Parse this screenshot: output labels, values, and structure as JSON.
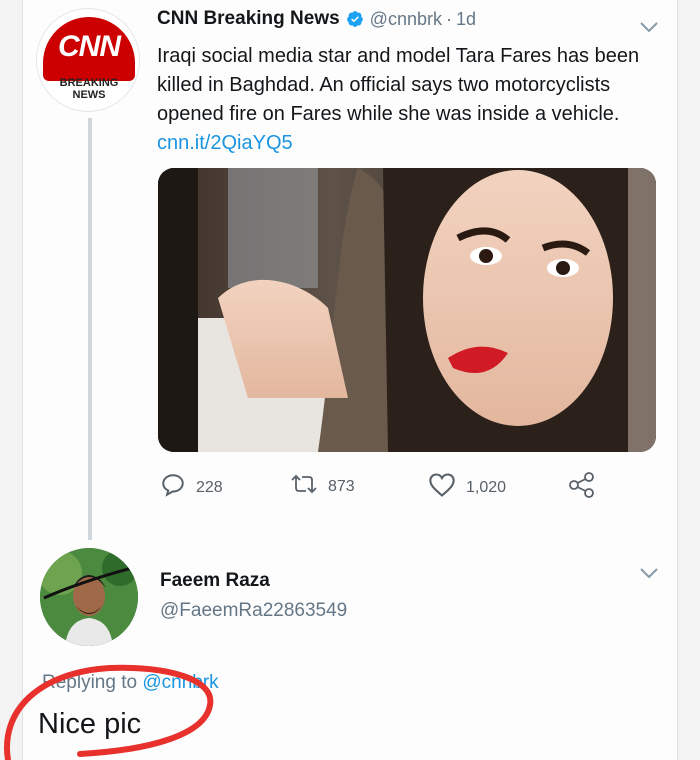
{
  "tweet": {
    "author_name": "CNN Breaking News",
    "handle": "@cnnbrk",
    "separator": "·",
    "time": "1d",
    "text": "Iraqi social media star and model Tara Fares has been killed in Baghdad. An official says two motorcyclists opened fire on Fares while she was inside a vehicle.",
    "link": "cnn.it/2QiaYQ5",
    "avatar": {
      "logo_text": "CNN",
      "line1": "BREAKING",
      "line2": "NEWS"
    },
    "actions": {
      "replies": "228",
      "retweets": "873",
      "likes": "1,020"
    }
  },
  "reply": {
    "author_name": "Faeem Raza",
    "handle": "@FaeemRa22863549",
    "replying_label": "Replying to",
    "replying_to": "@cnnbrk",
    "text": "Nice pic"
  },
  "colors": {
    "cnn_red": "#cc0000",
    "link_blue": "#1b95e0",
    "muted_gray": "#657786",
    "annotation_red": "#e8302c"
  },
  "icons": [
    "verified-badge-icon",
    "chevron-down-icon",
    "reply-icon",
    "retweet-icon",
    "like-icon",
    "share-icon"
  ]
}
